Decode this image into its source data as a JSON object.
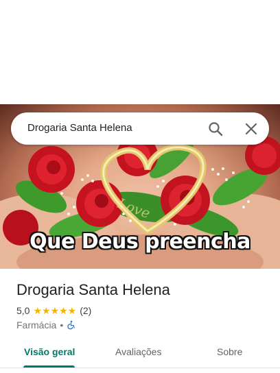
{
  "search": {
    "query": "Drogaria Santa Helena"
  },
  "hero": {
    "caption": "Que Deus preencha",
    "overlay_text": "Love"
  },
  "place": {
    "name": "Drogaria Santa Helena",
    "rating": "5,0",
    "stars": "★★★★★",
    "review_count": "(2)",
    "category": "Farmácia",
    "separator": "•",
    "accessibility_icon": "wheelchair-icon"
  },
  "tabs": [
    {
      "label": "Visão geral",
      "active": true
    },
    {
      "label": "Avaliações",
      "active": false
    },
    {
      "label": "Sobre",
      "active": false
    }
  ],
  "colors": {
    "accent": "#00796b",
    "star": "#f5b400",
    "accessibility": "#1a73e8"
  }
}
